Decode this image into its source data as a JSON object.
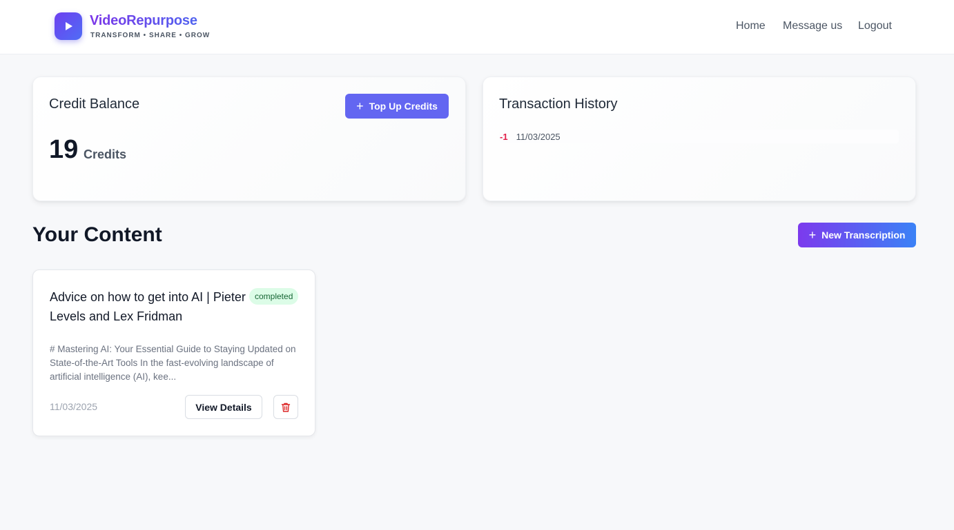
{
  "header": {
    "brand": "VideoRepurpose",
    "tagline": "TRANSFORM • SHARE • GROW",
    "logo_icon": "play-icon",
    "nav": [
      {
        "label": "Home"
      },
      {
        "label": "Message us"
      },
      {
        "label": "Logout"
      }
    ]
  },
  "credit_balance": {
    "title": "Credit Balance",
    "top_up_label": "Top Up Credits",
    "amount": "19",
    "unit": "Credits"
  },
  "transaction_history": {
    "title": "Transaction History",
    "items": [
      {
        "amount": "-1",
        "date": "11/03/2025"
      }
    ]
  },
  "content": {
    "title": "Your Content",
    "new_button_label": "New Transcription",
    "items": [
      {
        "title": "Advice on how to get into AI | Pieter Levels and Lex Fridman",
        "status": "completed",
        "excerpt": "# Mastering AI: Your Essential Guide to Staying Updated on State-of-the-Art Tools In the fast-evolving landscape of artificial intelligence (AI), kee...",
        "date": "11/03/2025",
        "view_label": "View Details",
        "delete_icon": "trash-icon"
      }
    ]
  },
  "colors": {
    "accent": "#6366f1",
    "gradient_start": "#7c3aed",
    "gradient_end": "#3b82f6",
    "status_completed_bg": "#dcfce7",
    "negative": "#e11d48"
  }
}
